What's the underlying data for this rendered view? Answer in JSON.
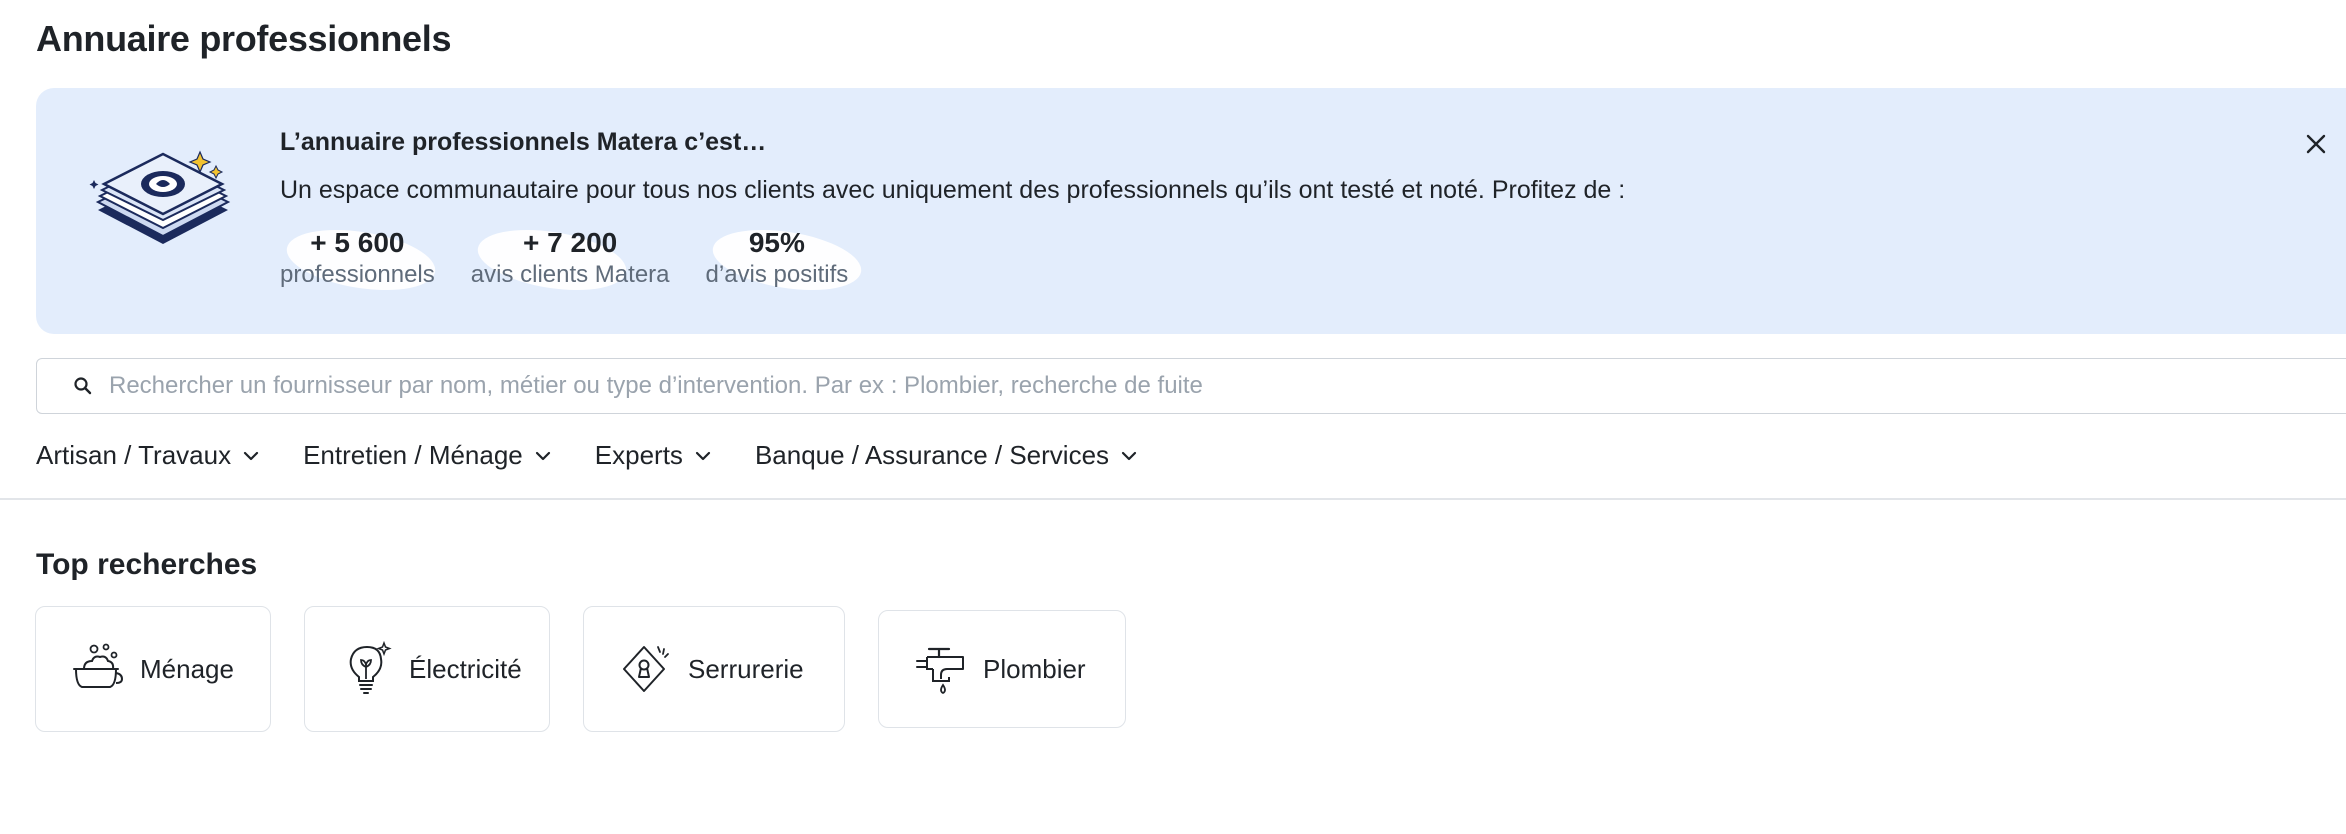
{
  "page": {
    "title": "Annuaire professionnels"
  },
  "banner": {
    "title": "L’annuaire professionnels Matera c’est…",
    "text": "Un espace communautaire pour tous nos clients avec uniquement des professionnels qu’ils ont testé et noté. Profitez de :",
    "stats": [
      {
        "value": "+ 5 600",
        "label": "professionnels"
      },
      {
        "value": "+ 7 200",
        "label": "avis clients Matera"
      },
      {
        "value": "95%",
        "label": "d’avis positifs"
      }
    ],
    "icons": {
      "illustration": "directory-book-illustration",
      "close": "close-icon"
    }
  },
  "search": {
    "value": "",
    "placeholder": "Rechercher un fournisseur par nom, métier ou type d’intervention. Par ex : Plombier, recherche de fuite"
  },
  "categories": [
    {
      "label": "Artisan / Travaux"
    },
    {
      "label": "Entretien / Ménage"
    },
    {
      "label": "Experts"
    },
    {
      "label": "Banque / Assurance / Services"
    }
  ],
  "top_searches": {
    "title": "Top recherches",
    "items": [
      {
        "label": "Ménage",
        "icon": "cleaning-bucket-icon"
      },
      {
        "label": "Électricité",
        "icon": "light-bulb-icon"
      },
      {
        "label": "Serrurerie",
        "icon": "keyhole-icon"
      },
      {
        "label": "Plombier",
        "icon": "water-tap-icon"
      }
    ]
  },
  "colors": {
    "banner_bg": "#e3edfc",
    "text": "#1f2328",
    "muted": "#5f6b7a",
    "navy": "#1b2a5c",
    "accent_yellow": "#f2c230"
  }
}
